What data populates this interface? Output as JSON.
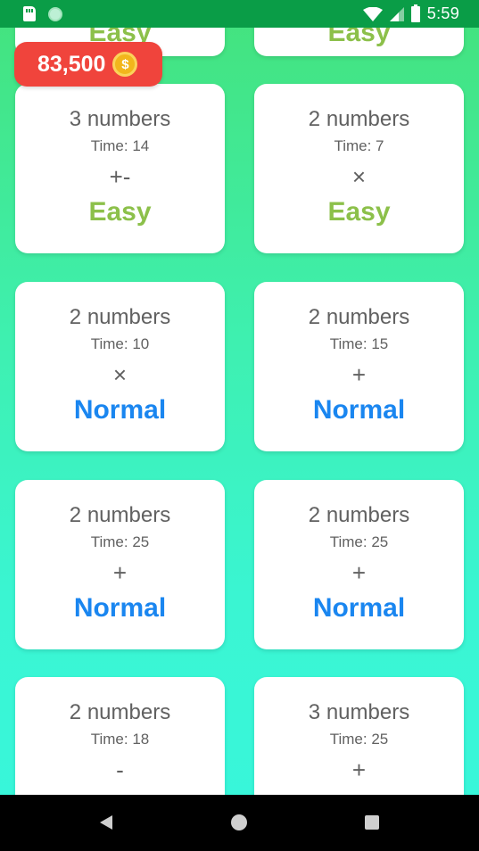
{
  "status_bar": {
    "time": "5:59"
  },
  "coins": {
    "amount": "83,500",
    "coin_symbol": "$"
  },
  "top_partial": [
    {
      "level": "Easy"
    },
    {
      "level": "Easy"
    }
  ],
  "cards": [
    {
      "numbers": "3 numbers",
      "time": "Time: 14",
      "op": "+-",
      "level": "Easy"
    },
    {
      "numbers": "2 numbers",
      "time": "Time: 7",
      "op": "×",
      "level": "Easy"
    },
    {
      "numbers": "2 numbers",
      "time": "Time: 10",
      "op": "×",
      "level": "Normal"
    },
    {
      "numbers": "2 numbers",
      "time": "Time: 15",
      "op": "+",
      "level": "Normal"
    },
    {
      "numbers": "2 numbers",
      "time": "Time: 25",
      "op": "+",
      "level": "Normal"
    },
    {
      "numbers": "2 numbers",
      "time": "Time: 25",
      "op": "+",
      "level": "Normal"
    },
    {
      "numbers": "2 numbers",
      "time": "Time: 18",
      "op": "-",
      "level": ""
    },
    {
      "numbers": "3 numbers",
      "time": "Time: 25",
      "op": "+",
      "level": ""
    }
  ]
}
